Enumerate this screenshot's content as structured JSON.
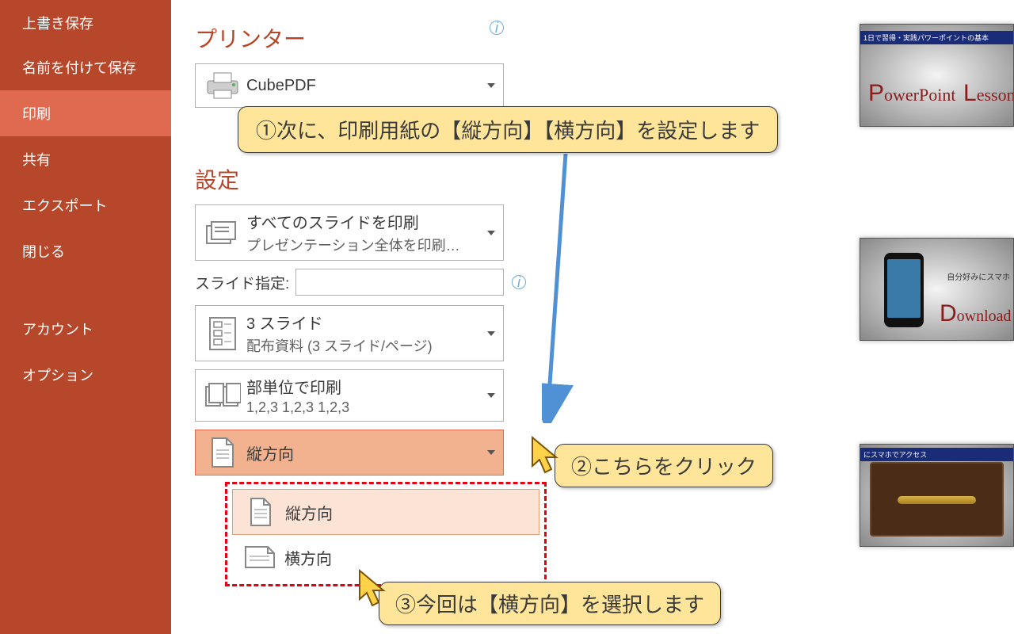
{
  "sidebar": {
    "items": [
      {
        "label": "上書き保存"
      },
      {
        "label": "名前を付けて保存"
      },
      {
        "label": "印刷"
      },
      {
        "label": "共有"
      },
      {
        "label": "エクスポート"
      },
      {
        "label": "閉じる"
      },
      {
        "label": "アカウント"
      },
      {
        "label": "オプション"
      }
    ]
  },
  "printer": {
    "section_title": "プリンター",
    "name": "CubePDF"
  },
  "settings": {
    "section_title": "設定",
    "print_all": {
      "line1": "すべてのスライドを印刷",
      "line2": "プレゼンテーション全体を印刷…"
    },
    "slide_spec_label": "スライド指定:",
    "slide_spec_value": "",
    "layout": {
      "line1": "3 スライド",
      "line2": "配布資料 (3 スライド/ページ)"
    },
    "collate": {
      "line1": "部単位で印刷",
      "line2": "1,2,3    1,2,3    1,2,3"
    },
    "orientation_current": "縦方向",
    "orientation_options": [
      {
        "label": "縦方向"
      },
      {
        "label": "横方向"
      }
    ]
  },
  "callouts": {
    "c1": "①次に、印刷用紙の【縦方向】【横方向】を設定します",
    "c2": "②こちらをクリック",
    "c3": "③今回は【横方向】を選択します"
  },
  "thumbs": {
    "t1_bar": "1日で習得・実践パワーポイントの基本",
    "t1_left": "PowerPoint",
    "t1_right": "Lesson",
    "t2_text1": "自分好みにスマホ",
    "t2_text2": "Download",
    "t3_bar": "にスマホでアクセス"
  }
}
